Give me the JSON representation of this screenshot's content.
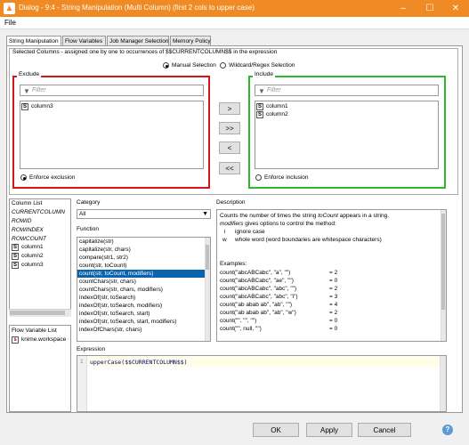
{
  "window": {
    "title": "Dialog - 9:4 - String Manipulation (Multi Column) (first 2 cols to upper case)",
    "icon": "knime-icon"
  },
  "menu": {
    "file": "File"
  },
  "tabs": [
    {
      "label": "String Manipulation",
      "active": true
    },
    {
      "label": "Flow Variables"
    },
    {
      "label": "Job Manager Selection"
    },
    {
      "label": "Memory Policy"
    }
  ],
  "columns_panel": {
    "title": "Selected Columns - assigned one by one to occurrences of $$CURRENTCOLUMN$$ in the expression",
    "mode_manual": "Manual Selection",
    "mode_wildcard": "Wildcard/Regex Selection",
    "exclude": {
      "title": "Exclude",
      "filter_placeholder": "Filter",
      "items": [
        "column3"
      ],
      "enforce": "Enforce exclusion"
    },
    "include": {
      "title": "Include",
      "filter_placeholder": "Filter",
      "items": [
        "column1",
        "column2"
      ],
      "enforce": "Enforce inclusion"
    },
    "buttons": {
      "add": ">",
      "add_all": ">>",
      "remove": "<",
      "remove_all": "<<"
    }
  },
  "column_list": {
    "title": "Column List",
    "specials": [
      "CURRENTCOLUMN",
      "ROWID",
      "ROWINDEX",
      "ROWCOUNT"
    ],
    "columns": [
      "column1",
      "column2",
      "column3"
    ],
    "type_icon": "S"
  },
  "flow_variable_list": {
    "title": "Flow Variable List",
    "items": [
      "knime.workspace"
    ],
    "icon": "s"
  },
  "category": {
    "label": "Category",
    "value": "All"
  },
  "function": {
    "label": "Function",
    "items": [
      "capitalize(str)",
      "capitalize(str, chars)",
      "compare(str1, str2)",
      "count(str, toCount)",
      "count(str, toCount, modifiers)",
      "countChars(str, chars)",
      "countChars(str, chars, modifiers)",
      "indexOf(str, toSearch)",
      "indexOf(str, toSearch, modifiers)",
      "indexOf(str, toSearch, start)",
      "indexOf(str, toSearch, start, modifiers)",
      "indexOfChars(str, chars)"
    ],
    "selected_index": 4
  },
  "description": {
    "label": "Description",
    "intro_a": "Counts the number of times the string",
    "intro_b": "toCount",
    "intro_c": "appears in a string.",
    "intro2_a": "modifiers",
    "intro2_b": "gives options to control the method:",
    "mod1_key": "i",
    "mod1_text": "ignore case",
    "mod2_key": "w",
    "mod2_text": "whole word (word boundaries are whitespace characters)",
    "examples_label": "Examples:",
    "examples": [
      {
        "call": "count(\"abcABCabc\", \"a\", \"\")",
        "result": "= 2"
      },
      {
        "call": "count(\"abcABCabc\", \"ae\", \"\")",
        "result": "= 0"
      },
      {
        "call": "count(\"abcABCabc\", \"abc\", \"\")",
        "result": "= 2"
      },
      {
        "call": "count(\"abcABCabc\", \"abc\", \"i\")",
        "result": "= 3"
      },
      {
        "call": "count(\"ab abab ab\", \"ab\", \"\")",
        "result": "= 4"
      },
      {
        "call": "count(\"ab abab ab\", \"ab\", \"w\")",
        "result": "= 2"
      },
      {
        "call": "count(\"\", \"\", \"\")",
        "result": "= 0"
      },
      {
        "call": "count(\"\", null, \"\")",
        "result": "= 0"
      }
    ]
  },
  "expression": {
    "label": "Expression",
    "line_number": "1",
    "code_a": "upperCase(",
    "code_b": "$$CURRENTCOLUMN$$)"
  },
  "footer": {
    "ok": "OK",
    "apply": "Apply",
    "cancel": "Cancel",
    "help_icon": "help-icon"
  },
  "colors": {
    "titlebar": "#f08a24",
    "exclude_border": "#d01818",
    "include_border": "#2eb82e",
    "selection": "#0a64ad",
    "expression_bg": "#fffde6"
  }
}
